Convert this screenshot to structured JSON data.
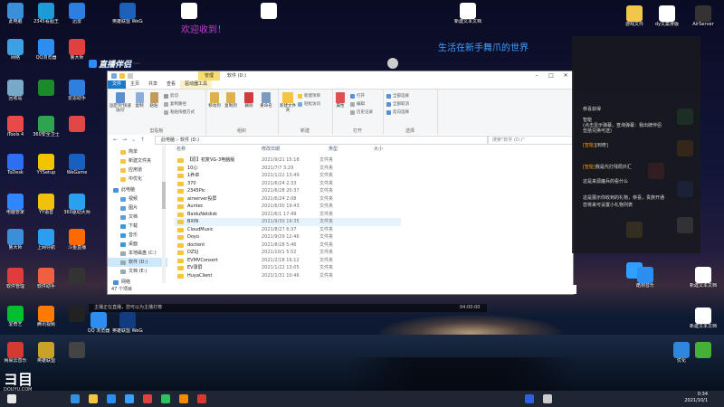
{
  "desktop": {
    "icons": [
      {
        "label": "此电脑",
        "color": "#3a8fd8"
      },
      {
        "label": "2345看图王",
        "color": "#1e9bd7"
      },
      {
        "label": "迅雷",
        "color": "#2e7de0"
      },
      {
        "label": "网络",
        "color": "#3da0e0"
      },
      {
        "label": "QQ浏览器",
        "color": "#2b8ef0"
      },
      {
        "label": "鲁大师",
        "color": "#e04040"
      },
      {
        "label": "回收站",
        "color": "#7aa8c8"
      },
      {
        "label": "",
        "color": "#1a8a2a"
      },
      {
        "label": "爱思助手",
        "color": "#2f7fe0"
      },
      {
        "label": "iTools 4",
        "color": "#e84a4a"
      },
      {
        "label": "360安全卫士",
        "color": "#2ea44f"
      },
      {
        "label": "",
        "color": "#e04848"
      },
      {
        "label": "ToDesk",
        "color": "#2d6ff0"
      },
      {
        "label": "YYSetup",
        "color": "#f0c400"
      },
      {
        "label": "WeGame",
        "color": "#1860c0"
      },
      {
        "label": "电脑管家",
        "color": "#2f86ff"
      },
      {
        "label": "YY语音",
        "color": "#f2c10c"
      },
      {
        "label": "360驱动大师",
        "color": "#2aa0f0"
      },
      {
        "label": "鲁大师",
        "color": "#3a8fd8"
      },
      {
        "label": "上网导航",
        "color": "#2b9ef0"
      },
      {
        "label": "斗鱼直播",
        "color": "#ff6a00"
      },
      {
        "label": "软件管理",
        "color": "#e23b3b"
      },
      {
        "label": "软件助手",
        "color": "#f06040"
      },
      {
        "label": "",
        "color": "#333"
      },
      {
        "label": "爱奇艺",
        "color": "#00c030"
      },
      {
        "label": "腾讯视频",
        "color": "#ff7a00"
      },
      {
        "label": "",
        "color": "#222"
      },
      {
        "label": "网易云音乐",
        "color": "#d33a31"
      },
      {
        "label": "英雄联盟",
        "color": "#c9a227"
      },
      {
        "label": "",
        "color": "#444"
      },
      {
        "label": "游戏中心",
        "color": "#2e3d5c"
      },
      {
        "label": "EV录屏",
        "color": "#1a8be0"
      },
      {
        "label": "",
        "color": "#333"
      },
      {
        "label": "英雄联盟 WeGame版",
        "color": "#1e5fb8"
      },
      {
        "label": "QQ 浏览器",
        "color": "#2b8ef0"
      },
      {
        "label": "英雄联盟 WeGame版",
        "color": "#123c80"
      },
      {
        "label": "",
        "color": "#fff"
      },
      {
        "label": "",
        "color": "#fff"
      },
      {
        "label": "新建文本文档",
        "color": "#fff"
      },
      {
        "label": "游戏文件",
        "color": "#f3c64b"
      },
      {
        "label": "dy文案排版",
        "color": "#fff"
      },
      {
        "label": "AirServer",
        "color": "#333"
      },
      {
        "label": "",
        "color": "#f0c040"
      },
      {
        "label": "",
        "color": "#30a0ff"
      },
      {
        "label": "",
        "color": "#e04040"
      },
      {
        "label": "",
        "color": "#30c060"
      },
      {
        "label": "",
        "color": "#f08a00"
      },
      {
        "label": "",
        "color": "#3060e0"
      },
      {
        "label": "",
        "color": "#e0e0e0"
      },
      {
        "label": "酷狗音乐",
        "color": "#2b8ef0"
      },
      {
        "label": "新建文本文档",
        "color": "#fff"
      },
      {
        "label": "优化",
        "color": "#2e86de"
      },
      {
        "label": "",
        "color": "#44b035"
      },
      {
        "label": "新建文本文档",
        "color": "#fff"
      }
    ],
    "banner_left": "欢迎收到！",
    "banner_right": "生活在新手舞爪的世界"
  },
  "stream": {
    "logo": "直播伴侣",
    "tag": "",
    "bottom_text": "主播正在直播，您可以为主播打榜",
    "bottom_time": "04:00:00"
  },
  "explorer": {
    "ctx_tab": "管理",
    "title": "软件 (D:)",
    "ribbon_tabs": [
      "文件",
      "主页",
      "共享",
      "查看",
      "驱动器工具"
    ],
    "ribbon": {
      "clipboard_group": "剪贴板",
      "organize_group": "组织",
      "new_group": "新建",
      "open_group": "打开",
      "select_group": "选择",
      "pin_label": "固定到'快速访问'",
      "copy_label": "复制",
      "paste_label": "粘贴",
      "cut_label": "剪切",
      "copy_path_label": "复制路径",
      "paste_shortcut_label": "粘贴快捷方式",
      "move_to_label": "移动到",
      "copy_to_label": "复制到",
      "delete_label": "删除",
      "rename_label": "重命名",
      "new_folder_label": "新建文件夹",
      "new_item_label": "新建项目",
      "easy_access_label": "轻松访问",
      "properties_label": "属性",
      "open_label": "打开",
      "edit_label": "编辑",
      "history_label": "历史记录",
      "select_all_label": "全部选择",
      "select_none_label": "全部取消",
      "invert_label": "反向选择"
    },
    "address": [
      "此电脑",
      "软件 (D:)"
    ],
    "search_placeholder": "搜索\"软件 (D:)\"",
    "nav_items": [
      "简单",
      "新建文件夹",
      "应用道",
      "中优化",
      "此电脑",
      "视频",
      "图片",
      "文档",
      "下载",
      "音乐",
      "桌面",
      "本地磁盘 (C:)",
      "软件 (D:)",
      "文档 (E:)",
      "网络"
    ],
    "columns": [
      "名称",
      "修改日期",
      "类型",
      "大小"
    ],
    "files": [
      {
        "name": "【原】初复VG-3电脑版",
        "date": "2021/9/21 15:18",
        "type": "文件夹"
      },
      {
        "name": "10心",
        "date": "2021/7/7 3:29",
        "type": "文件夹"
      },
      {
        "name": "1养卓",
        "date": "2021/1/22 13:49",
        "type": "文件夹"
      },
      {
        "name": "370",
        "date": "2021/6/24 2:33",
        "type": "文件夹"
      },
      {
        "name": "2345Pic",
        "date": "2021/6/28 20:37",
        "type": "文件夹"
      },
      {
        "name": "airserver投屏",
        "date": "2021/6/24 2:08",
        "type": "文件夹"
      },
      {
        "name": "Auntec",
        "date": "2021/6/30 19:43",
        "type": "文件夹"
      },
      {
        "name": "BaiduNetdisk",
        "date": "2021/6/1 17:49",
        "type": "文件夹"
      },
      {
        "name": "BXIN",
        "date": "2021/9/30 19:35",
        "type": "文件夹"
      },
      {
        "name": "CloudMusic",
        "date": "2021/8/27 6:37",
        "type": "文件夹"
      },
      {
        "name": "Doyo",
        "date": "2021/9/29 12:46",
        "type": "文件夹"
      },
      {
        "name": "doctent",
        "date": "2021/8/28 5:46",
        "type": "文件夹"
      },
      {
        "name": "DZSJ",
        "date": "2021/10/1 5:52",
        "type": "文件夹"
      },
      {
        "name": "EVMVConsert",
        "date": "2021/2/18 19:12",
        "type": "文件夹"
      },
      {
        "name": "EV录屏",
        "date": "2021/1/22 13:05",
        "type": "文件夹"
      },
      {
        "name": "HuyaClient",
        "date": "2021/1/31 10:46",
        "type": "文件夹"
      }
    ],
    "status": "47 个项目"
  },
  "chat": {
    "lines": [
      {
        "name": "",
        "text": "恭喜获得"
      },
      {
        "name": "",
        "text": "智能"
      },
      {
        "name": "",
        "text": "(点击显示弹幕，查询弹幕：我出牌伴侣"
      },
      {
        "name": "",
        "text": "伍拾兑换可送)"
      },
      {
        "name": "[智能]",
        "text": "[到奇]"
      },
      {
        "name": "[智能]",
        "text": "我是代打残局外汇"
      },
      {
        "name": "",
        "text": "这是来源魔兵的看什么"
      },
      {
        "name": "",
        "text": "这是展示你收到的礼物，恭喜，贵族开通"
      },
      {
        "name": "",
        "text": "您将来可设置小礼物列表"
      }
    ]
  },
  "taskbar": {
    "time": "0:34",
    "date": "2021/10/1"
  },
  "colors": {
    "explorer_accent": "#1979ca",
    "folder": "#f5c542",
    "ctx_tab": "#f6dd6e",
    "taskbar": "#1f2633"
  }
}
